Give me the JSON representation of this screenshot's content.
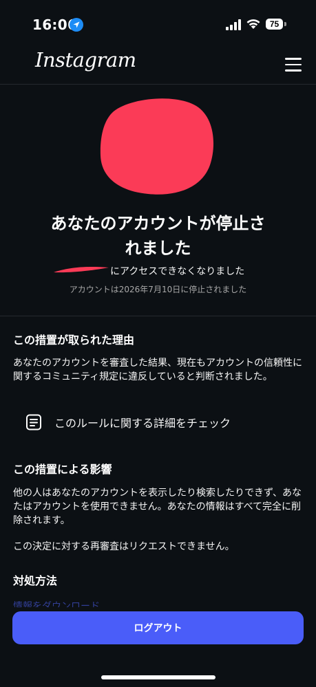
{
  "status_bar": {
    "time": "16:06",
    "battery": "75",
    "icons": [
      "location-arrow-icon",
      "cellular-signal-icon",
      "wifi-icon",
      "battery-icon"
    ]
  },
  "header": {
    "logo": "Instagram",
    "menu_icon": "hamburger-menu-icon"
  },
  "suspension": {
    "title_line1": "あなたのアカウントが停止さ",
    "title_line2": "れました",
    "subtitle_suffix": "にアクセスできなくなりました",
    "note": "アカウントは2026年7月10日に停止されました"
  },
  "reason": {
    "heading": "この措置が取られた理由",
    "body": "あなたのアカウントを審査した結果、現在もアカウントの信頼性に関するコミュニティ規定に違反していると判断されました。",
    "rule_link": "このルールに関する詳細をチェック"
  },
  "impact": {
    "heading": "この措置による影響",
    "body1": "他の人はあなたのアカウントを表示したり検索したりできず、あなたはアカウントを使用できません。あなたの情報はすべて完全に削除されます。",
    "body2": "この決定に対する再審査はリクエストできません。"
  },
  "actions": {
    "heading": "対処方法",
    "partial_text": "情報をダウンロード"
  },
  "logout_button": "ログアウト",
  "colors": {
    "background": "#0c1014",
    "accent": "#4a5df9",
    "redaction": "#fb3b57"
  }
}
